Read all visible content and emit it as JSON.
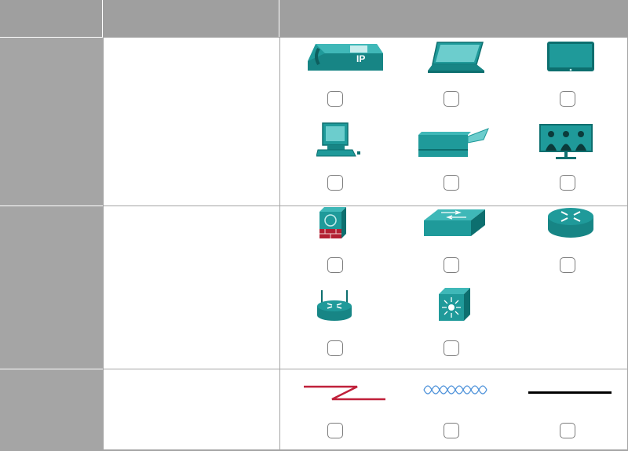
{
  "table": {
    "header": {
      "col1": "",
      "col2": "",
      "col3": ""
    },
    "rows": [
      {
        "category": "",
        "description": "",
        "devices": [
          {
            "name": "ip-phone",
            "icon": "ip-phone-icon",
            "label": "IP",
            "checked": false
          },
          {
            "name": "laptop",
            "icon": "laptop-icon",
            "checked": false
          },
          {
            "name": "tv",
            "icon": "tv-icon",
            "checked": false
          },
          {
            "name": "pc",
            "icon": "pc-icon",
            "checked": false
          },
          {
            "name": "printer",
            "icon": "printer-icon",
            "checked": false
          },
          {
            "name": "telepresence",
            "icon": "telepresence-icon",
            "checked": false
          }
        ]
      },
      {
        "category": "",
        "description": "",
        "devices": [
          {
            "name": "firewall",
            "icon": "firewall-icon",
            "checked": false
          },
          {
            "name": "switch",
            "icon": "switch-icon",
            "checked": false
          },
          {
            "name": "router",
            "icon": "router-icon",
            "checked": false
          },
          {
            "name": "wireless-router",
            "icon": "wireless-router-icon",
            "checked": false
          },
          {
            "name": "multilayer-switch",
            "icon": "multilayer-switch-icon",
            "checked": false
          }
        ]
      },
      {
        "category": "",
        "description": "",
        "devices": [
          {
            "name": "serial-wan-link",
            "icon": "serial-link-icon",
            "checked": false
          },
          {
            "name": "wireless-link",
            "icon": "wireless-link-icon",
            "checked": false
          },
          {
            "name": "ethernet-link",
            "icon": "ethernet-link-icon",
            "checked": false
          }
        ]
      }
    ]
  },
  "colors": {
    "teal": "#1f9a9a",
    "dark_teal": "#0d6f6f",
    "header_gray": "#9f9f9f",
    "red": "#c0203a",
    "blue": "#4a90d9"
  }
}
